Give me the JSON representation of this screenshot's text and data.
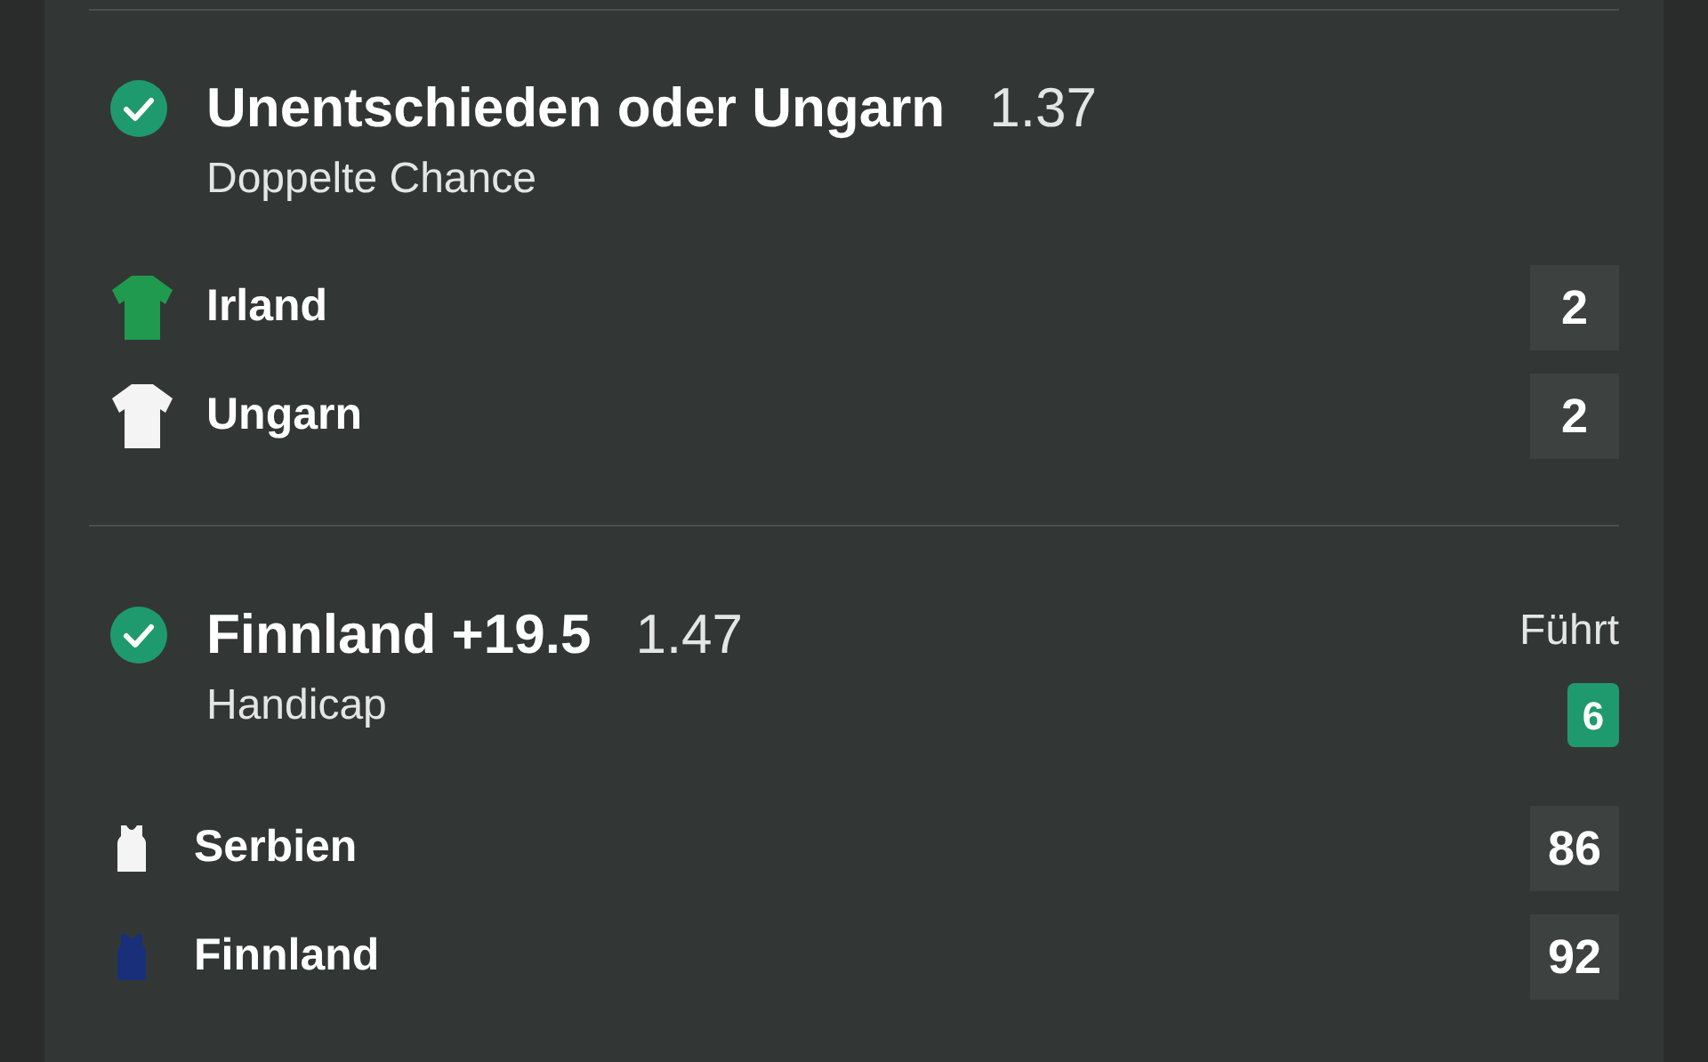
{
  "bets": [
    {
      "won": true,
      "selection": "Unentschieden oder Ungarn",
      "odds": "1.37",
      "market": "Doppelte Chance",
      "kind": "football",
      "teams": [
        {
          "name": "Irland",
          "color": "#1f9a4e",
          "score": "2"
        },
        {
          "name": "Ungarn",
          "color": "#f4f4f4",
          "score": "2"
        }
      ]
    },
    {
      "won": true,
      "selection": "Finnland +19.5",
      "odds": "1.47",
      "market": "Handicap",
      "kind": "basketball",
      "status": {
        "label": "Führt",
        "value": "6"
      },
      "teams": [
        {
          "name": "Serbien",
          "color": "#f4f4f4",
          "score": "86"
        },
        {
          "name": "Finnland",
          "color": "#1a2f7a",
          "score": "92"
        }
      ]
    }
  ]
}
